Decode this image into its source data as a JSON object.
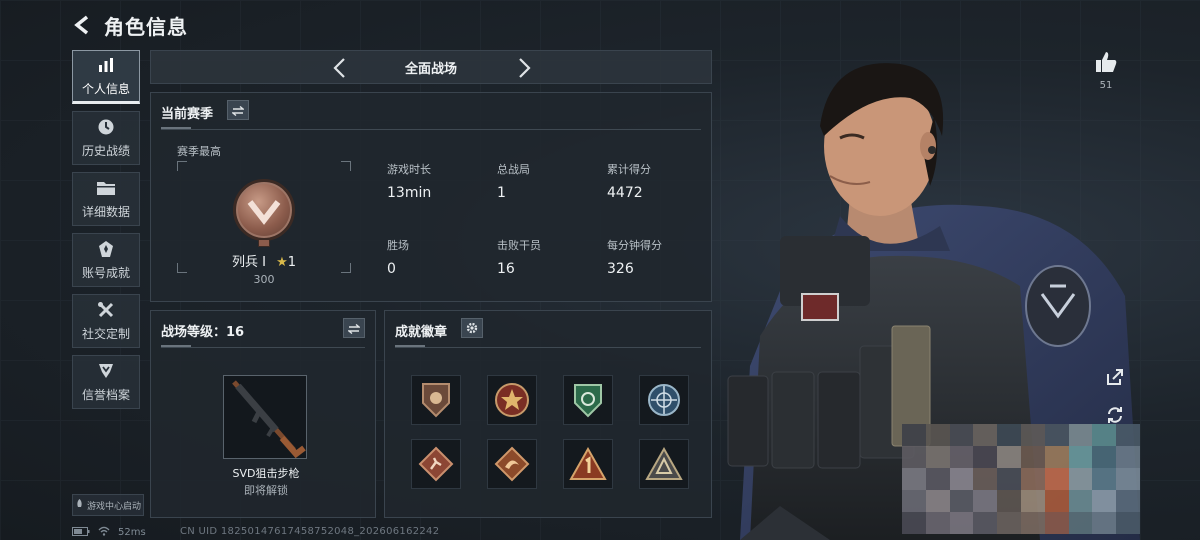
{
  "header": {
    "title": "角色信息"
  },
  "sidebar": {
    "items": [
      {
        "label": "个人信息",
        "active": true,
        "icon": "bar-chart-icon"
      },
      {
        "label": "历史战绩",
        "active": false,
        "icon": "clock-icon"
      },
      {
        "label": "详细数据",
        "active": false,
        "icon": "folder-icon"
      },
      {
        "label": "账号成就",
        "active": false,
        "icon": "medal-icon"
      },
      {
        "label": "社交定制",
        "active": false,
        "icon": "tools-icon"
      },
      {
        "label": "信誉档案",
        "active": false,
        "icon": "shield-icon"
      }
    ],
    "launch_badge": "游戏中心启动"
  },
  "mode": {
    "label": "全面战场"
  },
  "season": {
    "title": "当前赛季",
    "best_label": "赛季最高",
    "rank_name": "列兵 I",
    "rank_stars": "1",
    "rank_score": "300",
    "stats": [
      {
        "label": "游戏时长",
        "value": "13min"
      },
      {
        "label": "总战局",
        "value": "1"
      },
      {
        "label": "累计得分",
        "value": "4472"
      },
      {
        "label": "胜场",
        "value": "0"
      },
      {
        "label": "击败干员",
        "value": "16"
      },
      {
        "label": "每分钟得分",
        "value": "326"
      }
    ]
  },
  "battlefield": {
    "title": "战场等级：16",
    "weapon_name": "SVD狙击步枪",
    "weapon_status": "即将解锁"
  },
  "achievements": {
    "title": "成就徽章",
    "badges": [
      "lion-badge",
      "star-badge",
      "green-shield-badge",
      "globe-badge",
      "runner-badge",
      "dragon-badge",
      "rank-1-badge",
      "triangle-badge"
    ]
  },
  "likes": {
    "count": "51"
  },
  "status": {
    "ping": "52ms",
    "uid": "CN UID 18250147617458752048_202606162242"
  },
  "colors": {
    "accent": "#e8ecef",
    "panel": "#20272e",
    "medal": "#8c5c4c"
  }
}
